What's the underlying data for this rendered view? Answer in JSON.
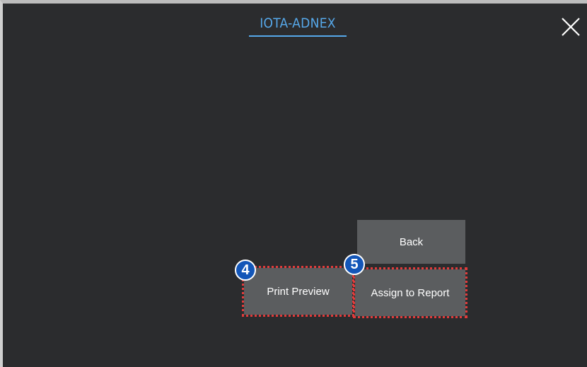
{
  "header": {
    "tab_title": "IOTA-ADNEX"
  },
  "icons": {
    "close": "close-icon"
  },
  "buttons": {
    "back": "Back",
    "print_preview": "Print Preview",
    "assign_to_report": "Assign to Report"
  },
  "annotations": {
    "print_preview_step": "4",
    "assign_step": "5"
  },
  "colors": {
    "background": "#2b2c2e",
    "accent": "#56a8ea",
    "button": "#5b5d5f",
    "highlight": "#e23a3a",
    "badge": "#1356b8"
  }
}
